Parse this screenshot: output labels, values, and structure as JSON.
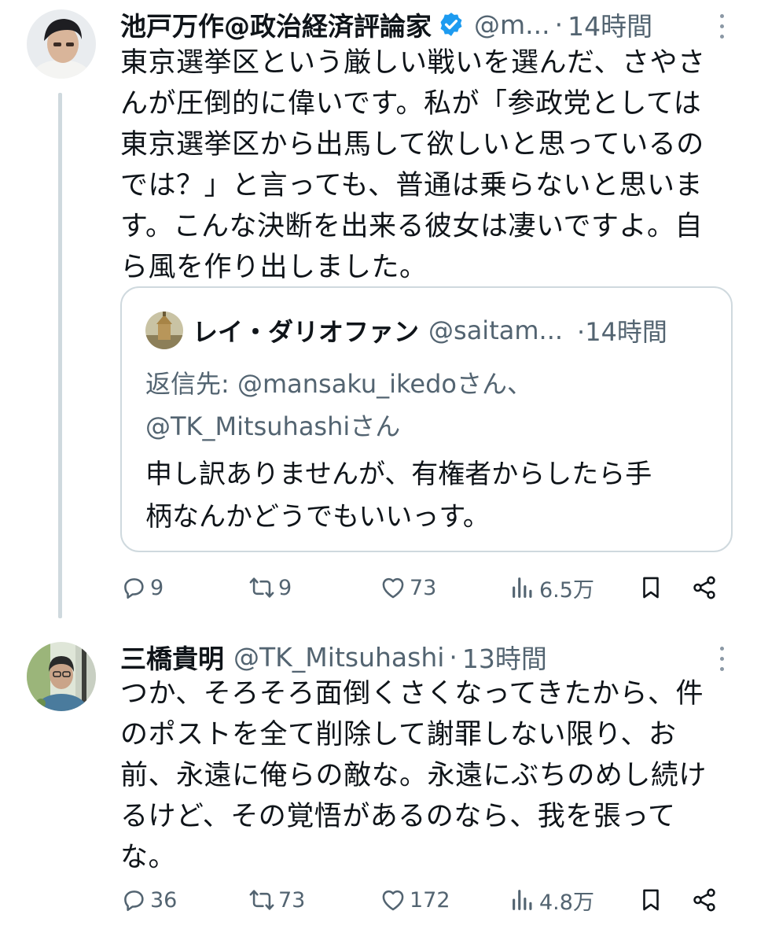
{
  "tweet1": {
    "author_name": "池戸万作@政治経済評論家",
    "verified": true,
    "handle": "@m...",
    "dot": "·",
    "time": "14時間",
    "text_lines": [
      "東京選挙区という厳しい戦いを選んだ、さやさ",
      "んが圧倒的に偉いです。私が「参政党としては",
      "東京選挙区から出馬して欲しいと思っているの",
      "では？」と言っても、普通は乗らないと思いま",
      "す。こんな決断を出来る彼女は凄いですよ。自",
      "ら風を作り出しました。"
    ],
    "quote": {
      "author_name": "レイ・ダリオファン",
      "handle": "@saitam...",
      "time": "·14時間",
      "reply_label": "返信先:",
      "reply_mention_1": "@mansaku_ikedoさん、",
      "reply_mention_2": "@TK_Mitsuhashiさん",
      "text_lines": [
        "申し訳ありませんが、有権者からしたら手",
        "柄なんかどうでもいいっす。"
      ]
    },
    "actions": {
      "replies": "9",
      "retweets": "9",
      "likes": "73",
      "views": "6.5万"
    }
  },
  "tweet2": {
    "author_name": "三橋貴明",
    "handle": "@TK_Mitsuhashi",
    "dot": "·",
    "time": "13時間",
    "text_lines": [
      "つか、そろそろ面倒くさくなってきたから、件",
      "のポストを全て削除して謝罪しない限り、お",
      "前、永遠に俺らの敵な。永遠にぶちのめし続け",
      "るけど、その覚悟があるのなら、我を張って",
      "な。"
    ],
    "actions": {
      "replies": "36",
      "retweets": "73",
      "likes": "172",
      "views": "4.8万"
    }
  },
  "colors": {
    "text": "#0f1419",
    "secondary": "#536471",
    "verified_blue": "#1d9bf0",
    "border": "#cfd9de"
  },
  "icons": [
    "reply-icon",
    "retweet-icon",
    "like-icon",
    "views-icon",
    "bookmark-icon",
    "share-icon",
    "verified-badge-icon",
    "more-icon"
  ]
}
